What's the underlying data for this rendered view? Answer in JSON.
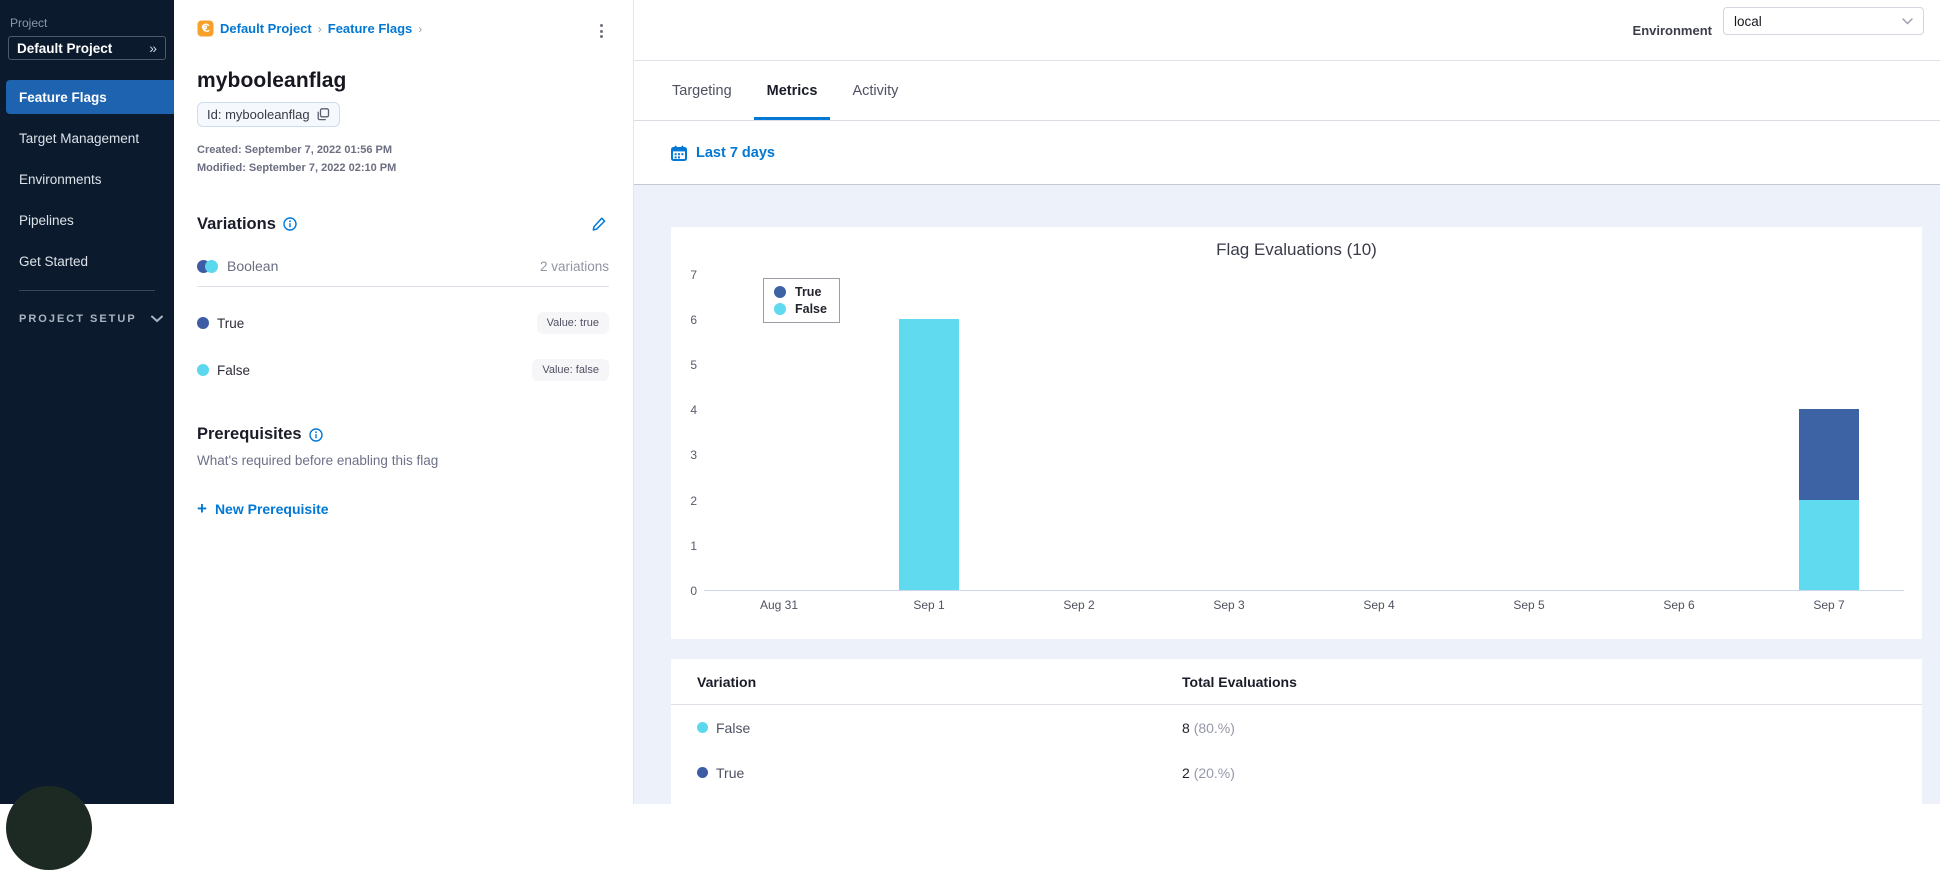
{
  "sidebar": {
    "project_label": "Project",
    "project_name": "Default Project",
    "items": [
      {
        "label": "Feature Flags",
        "active": true
      },
      {
        "label": "Target Management",
        "active": false
      },
      {
        "label": "Environments",
        "active": false
      },
      {
        "label": "Pipelines",
        "active": false
      },
      {
        "label": "Get Started",
        "active": false
      }
    ],
    "setup_label": "PROJECT SETUP"
  },
  "flag_panel": {
    "breadcrumb": [
      "Default Project",
      "Feature Flags"
    ],
    "title": "mybooleanflag",
    "id_chip": "Id: mybooleanflag",
    "created": "Created: September 7, 2022 01:56 PM",
    "modified": "Modified: September 7, 2022 02:10 PM",
    "variations": {
      "heading": "Variations",
      "type_label": "Boolean",
      "count_label": "2 variations",
      "items": [
        {
          "name": "True",
          "value_label": "Value: true",
          "color": "#3e5ca6"
        },
        {
          "name": "False",
          "value_label": "Value: false",
          "color": "#5bd8ee"
        }
      ]
    },
    "prerequisites": {
      "heading": "Prerequisites",
      "description": "What's required before enabling this flag",
      "new_button": "New Prerequisite"
    }
  },
  "header": {
    "environment_label": "Environment",
    "environment_value": "local"
  },
  "tabs": [
    {
      "label": "Targeting",
      "active": false
    },
    {
      "label": "Metrics",
      "active": true
    },
    {
      "label": "Activity",
      "active": false
    }
  ],
  "date_filter": "Last 7 days",
  "chart_data": {
    "type": "bar",
    "stacked": true,
    "title": "Flag Evaluations (10)",
    "categories": [
      "Aug 31",
      "Sep 1",
      "Sep 2",
      "Sep 3",
      "Sep 4",
      "Sep 5",
      "Sep 6",
      "Sep 7"
    ],
    "series": [
      {
        "name": "True",
        "color": "#3e63a4",
        "values": [
          0,
          0,
          0,
          0,
          0,
          0,
          0,
          2
        ]
      },
      {
        "name": "False",
        "color": "#5fdaee",
        "values": [
          0,
          6,
          0,
          0,
          0,
          0,
          0,
          2
        ]
      }
    ],
    "ylim": [
      0,
      7
    ],
    "yticks": [
      0,
      1,
      2,
      3,
      4,
      5,
      6,
      7
    ],
    "legend_position": "top-left",
    "grid": false
  },
  "table": {
    "columns": [
      "Variation",
      "Total Evaluations"
    ],
    "rows": [
      {
        "variation": "False",
        "color": "#5bd8ee",
        "total": "8",
        "percent": "(80.%)"
      },
      {
        "variation": "True",
        "color": "#3e5ca6",
        "total": "2",
        "percent": "(20.%)"
      }
    ]
  },
  "colors": {
    "accent_blue": "#0278d5",
    "nav_selected": "#1e63b0",
    "sidebar_bg": "#0b1b2d",
    "content_bg": "#edf1f9",
    "series_true": "#3e63a4",
    "series_false": "#5fdaee"
  }
}
